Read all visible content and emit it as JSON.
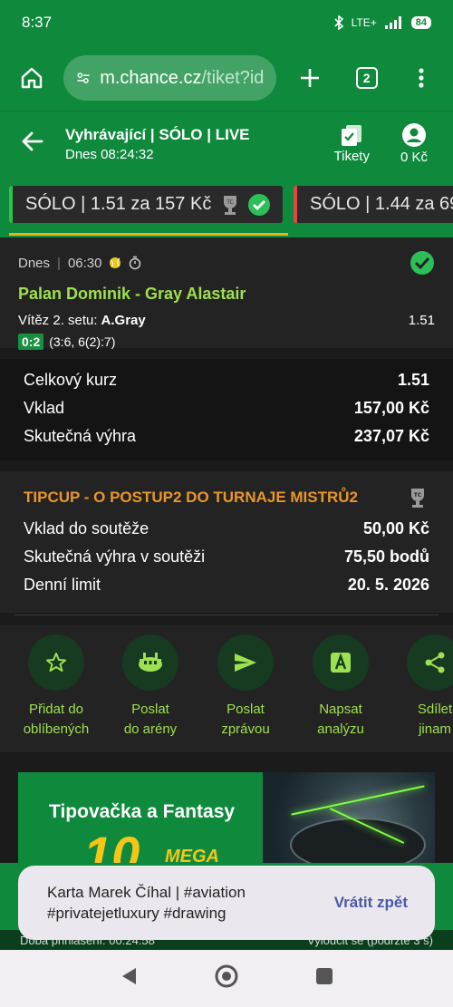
{
  "status": {
    "time": "8:37",
    "network": "LTE+",
    "battery": "84"
  },
  "browser": {
    "url_host": "m.chance.cz",
    "url_path": "/tiket?id",
    "tab_count": "2"
  },
  "header": {
    "title": "Vyhrávající | SÓLO | LIVE",
    "subtitle": "Dnes 08:24:32",
    "tickets_label": "Tikety",
    "balance_label": "0 Kč"
  },
  "tickets": [
    {
      "label": "SÓLO  | 1.51 za 157 Kč",
      "state": "win"
    },
    {
      "label": "SÓLO  | 1.44 za 69",
      "state": "lose"
    }
  ],
  "match": {
    "day": "Dnes",
    "time": "06:30",
    "teams": "Palan Dominik - Gray Alastair",
    "market": "Vítěz 2. setu:",
    "pick": "A.Gray",
    "odd": "1.51",
    "score": "0:2",
    "detail": "(3:6, 6(2):7)"
  },
  "summary": [
    {
      "label": "Celkový kurz",
      "value": "1.51"
    },
    {
      "label": "Vklad",
      "value": "157,00 Kč"
    },
    {
      "label": "Skutečná výhra",
      "value": "237,07 Kč"
    }
  ],
  "tipcup": {
    "title": "TIPCUP - O POSTUP2 DO TURNAJE MISTRŮ2",
    "rows": [
      {
        "label": "Vklad do soutěže",
        "value": "50,00 Kč"
      },
      {
        "label": "Skutečná výhra v soutěži",
        "value": "75,50 bodů"
      },
      {
        "label": "Denní limit",
        "value": "20. 5. 2026"
      }
    ]
  },
  "actions": [
    {
      "line1": "Přidat do",
      "line2": "oblíbených",
      "icon": "star-icon"
    },
    {
      "line1": "Poslat",
      "line2": "do arény",
      "icon": "arena-icon"
    },
    {
      "line1": "Poslat",
      "line2": "zprávou",
      "icon": "send-icon"
    },
    {
      "line1": "Napsat",
      "line2": "analýzu",
      "icon": "analysis-icon"
    },
    {
      "line1": "Sdílet",
      "line2": "jinam",
      "icon": "share-icon"
    }
  ],
  "banner": {
    "title": "Tipovačka a Fantasy",
    "big": "10",
    "mega": "MEGA"
  },
  "bottom": {
    "left": "Doba přihlášení: 00:24:58",
    "right": "Vyloučit se (podrzte 3 s)"
  },
  "toast": {
    "message": "Karta Marek Číhal | #aviation #privatejetluxury #drawing",
    "action": "Vrátit zpět"
  },
  "colors": {
    "brand": "#0f8a3c",
    "accent_green": "#9ee04f",
    "accent_orange": "#e9962b"
  }
}
